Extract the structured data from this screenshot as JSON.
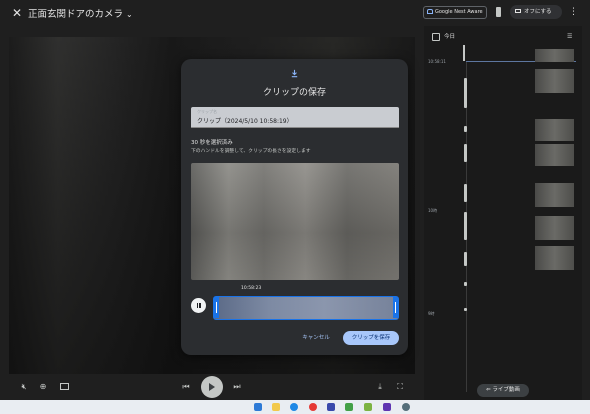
{
  "header": {
    "camera_title": "正面玄関ドアのカメラ",
    "nest_aware_label": "Google Nest Aware",
    "off_button_label": "オフにする"
  },
  "dialog": {
    "title": "クリップの保存",
    "name_field_label": "クリップ名",
    "name_field_value": "クリップ（2024/5/10 10:58:19）",
    "selected_text": "30 秒を選択済み",
    "hint_text": "下のハンドルを調整して、クリップの長さを設定します",
    "scrubber_time": "10:58:23",
    "cancel_label": "キャンセル",
    "save_label": "クリップを保存"
  },
  "timeline": {
    "today_label": "今日",
    "times": [
      "10:58:11",
      "10時",
      "9時"
    ],
    "live_button_label": "ライブ動画"
  },
  "colors": {
    "accent": "#1a73e8",
    "save_button": "#a8c7fa",
    "background": "#1f1f1f",
    "dialog": "#2b2d30"
  },
  "icons": {
    "close": "close-icon",
    "download": "download-icon",
    "pause": "pause-icon",
    "play": "play-icon",
    "calendar": "calendar-icon",
    "filter": "filter-icon"
  }
}
